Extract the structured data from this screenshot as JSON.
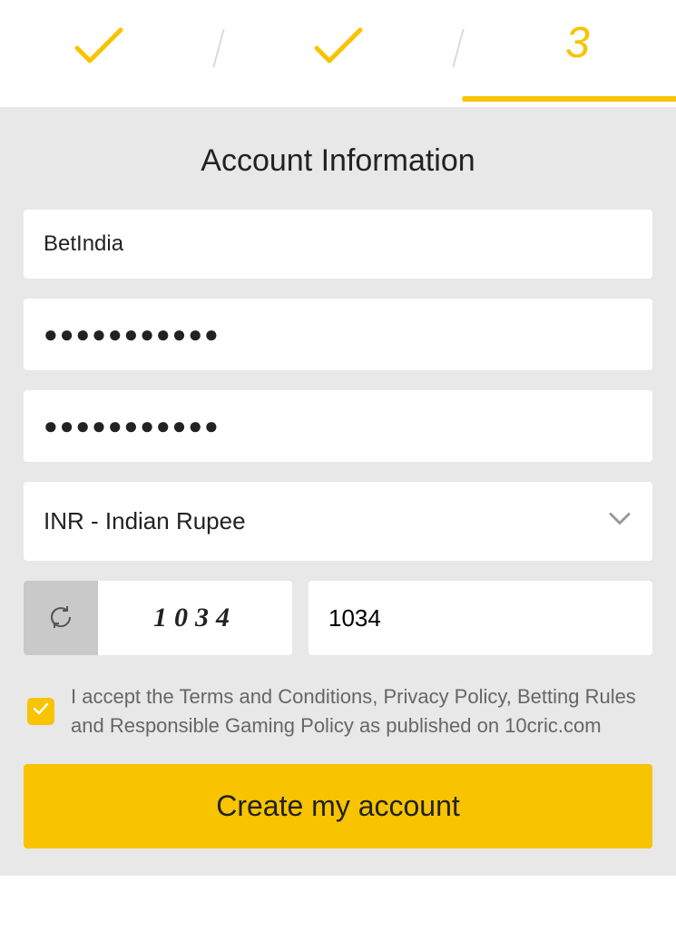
{
  "stepper": {
    "current": "3"
  },
  "title": "Account Information",
  "fields": {
    "username": "BetIndia",
    "password": "●●●●●●●●●●●",
    "password_confirm": "●●●●●●●●●●●",
    "currency": "INR - Indian Rupee"
  },
  "captcha": {
    "image_text": "1034",
    "input_value": "1034"
  },
  "terms": {
    "checked": true,
    "text": "I accept the Terms and Conditions, Privacy Policy, Betting Rules and Responsible Gaming Policy as published on 10cric.com"
  },
  "submit_label": "Create my account"
}
